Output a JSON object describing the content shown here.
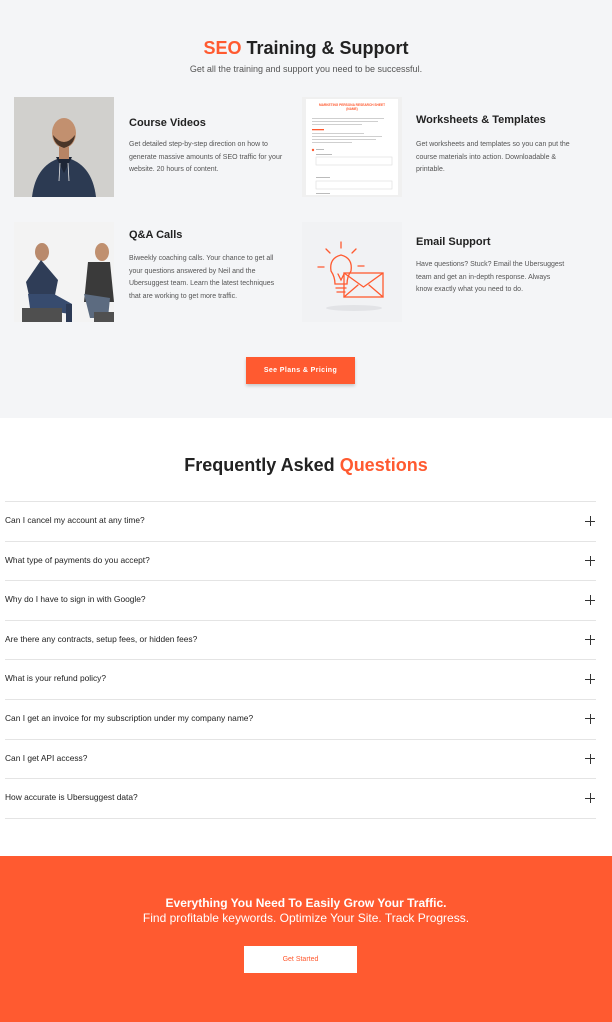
{
  "training": {
    "title_accent": "SEO",
    "title_rest": "Training & Support",
    "subtitle": "Get all the training and support you need to be successful.",
    "cards": [
      {
        "title": "Course Videos",
        "desc": "Get detailed step-by-step direction on how to generate massive amounts of SEO traffic for your website. 20 hours of content."
      },
      {
        "title": "Worksheets & Templates",
        "desc": "Get worksheets and templates so you can put the course materials into action. Downloadable & printable."
      },
      {
        "title": "Q&A Calls",
        "desc": "Biweekly coaching calls. Your chance to get all your questions answered by Neil and the Ubersuggest team. Learn the latest techniques that are working to get more traffic."
      },
      {
        "title": "Email Support",
        "desc": "Have questions? Stuck? Email the Ubersuggest team and get an in-depth response. Always know exactly what you need to do."
      }
    ],
    "worksheet_heading": "MARKETING PERSONA RESEARCH SHEET (NAME)",
    "plans_button": "See Plans & Pricing"
  },
  "faq": {
    "title_main": "Frequently Asked",
    "title_accent": "Questions",
    "items": [
      "Can I cancel my account at any time?",
      "What type of payments do you accept?",
      "Why do I have to sign in with Google?",
      "Are there any contracts, setup fees, or hidden fees?",
      "What is your refund policy?",
      "Can I get an invoice for my subscription under my company name?",
      "Can I get API access?",
      "How accurate is Ubersuggest data?"
    ]
  },
  "cta": {
    "headline": "Everything You Need To Easily Grow Your Traffic.",
    "subline": "Find profitable keywords. Optimize Your Site. Track Progress.",
    "button": "Get Started"
  },
  "colors": {
    "accent": "#ff5a30",
    "section_bg": "#f4f5f7"
  }
}
